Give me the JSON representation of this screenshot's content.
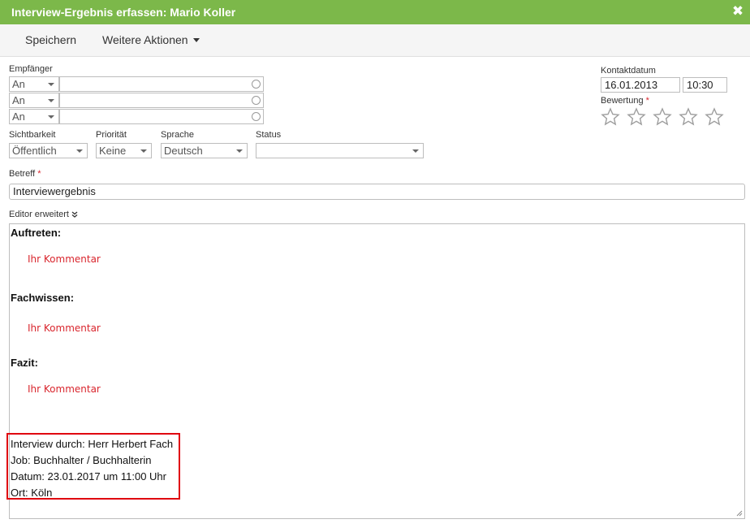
{
  "window": {
    "title": "Interview-Ergebnis erfassen: Mario Koller"
  },
  "toolbar": {
    "save_label": "Speichern",
    "more_actions_label": "Weitere Aktionen"
  },
  "recipients": {
    "label": "Empfänger",
    "rows": [
      {
        "type": "An",
        "value": ""
      },
      {
        "type": "An",
        "value": ""
      },
      {
        "type": "An",
        "value": ""
      }
    ]
  },
  "contact": {
    "date_label": "Kontaktdatum",
    "date": "16.01.2013",
    "time": "10:30"
  },
  "rating": {
    "label": "Bewertung",
    "required_mark": "*",
    "max_stars": 5,
    "value": 0
  },
  "fields": {
    "visibility": {
      "label": "Sichtbarkeit",
      "value": "Öffentlich"
    },
    "priority": {
      "label": "Priorität",
      "value": "Keine"
    },
    "language": {
      "label": "Sprache",
      "value": "Deutsch"
    },
    "status": {
      "label": "Status",
      "value": ""
    }
  },
  "subject": {
    "label": "Betreff",
    "required_mark": "*",
    "value": "Interviewergebnis"
  },
  "editor": {
    "toggle_label": "Editor erweitert",
    "sections": [
      {
        "heading": "Auftreten:",
        "comment": "Ihr Kommentar"
      },
      {
        "heading": "Fachwissen:",
        "comment": "Ihr Kommentar"
      },
      {
        "heading": "Fazit:",
        "comment": "Ihr Kommentar"
      }
    ],
    "info_lines": [
      "Interview durch: Herr Herbert Fach",
      "Job: Buchhalter / Buchhalterin",
      "Datum: 23.01.2017 um 11:00 Uhr",
      "Ort: Köln"
    ]
  },
  "colors": {
    "title_bar": "#7cb84a",
    "highlight_border": "#e0000f",
    "comment_text": "#d9262e",
    "required": "#d9262e"
  },
  "icons": {
    "close": "close-icon",
    "caret": "caret-down-icon",
    "lookup": "circle-lookup-icon",
    "star": "star-outline-icon",
    "resize": "resize-grip-icon"
  }
}
